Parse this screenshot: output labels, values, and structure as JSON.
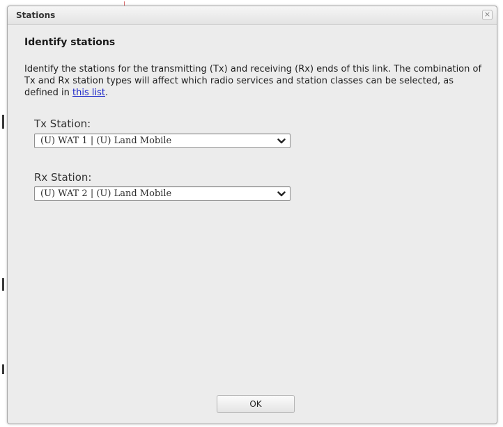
{
  "dialog": {
    "title": "Stations",
    "close_glyph": "×",
    "heading": "Identify stations",
    "description_before_link": "Identify the stations for the transmitting (Tx) and receiving (Rx) ends of this link. The combination of Tx and Rx station types will affect which radio services and station classes can be selected, as defined in ",
    "description_link": "this list",
    "description_after_link": ".",
    "tx": {
      "label": "Tx Station:",
      "value": "(U) WAT 1 | (U) Land Mobile"
    },
    "rx": {
      "label": "Rx Station:",
      "value": "(U) WAT 2 | (U) Land Mobile"
    },
    "ok_label": "OK"
  },
  "colors": {
    "link": "#1a25c8",
    "dialog_background": "#ececec"
  },
  "icons": {
    "close": "close-icon",
    "dropdown": "chevron-down-icon"
  }
}
